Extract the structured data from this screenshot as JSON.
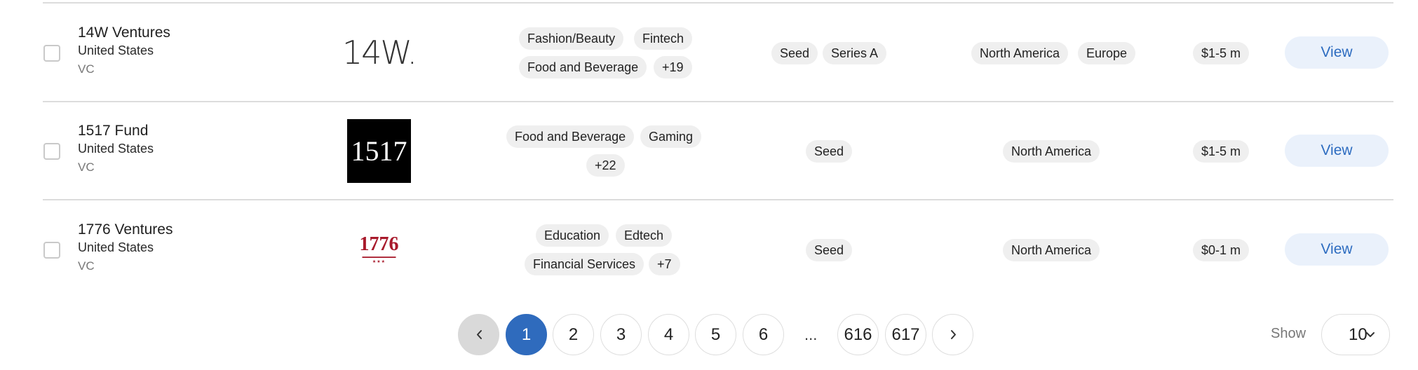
{
  "rows": [
    {
      "name": "14W Ventures",
      "country": "United States",
      "type": "VC",
      "logo_text": "14W.",
      "industries": [
        "Fashion/Beauty",
        "Fintech",
        "Food and Beverage",
        "+19"
      ],
      "stages": [
        "Seed",
        "Series A"
      ],
      "regions": [
        "North America",
        "Europe"
      ],
      "check_size": "$1-5 m",
      "action": "View"
    },
    {
      "name": "1517 Fund",
      "country": "United States",
      "type": "VC",
      "logo_text": "1517",
      "industries": [
        "Food and Beverage",
        "Gaming",
        "+22"
      ],
      "stages": [
        "Seed"
      ],
      "regions": [
        "North America"
      ],
      "check_size": "$1-5 m",
      "action": "View"
    },
    {
      "name": "1776 Ventures",
      "country": "United States",
      "type": "VC",
      "logo_text": "1776",
      "industries": [
        "Education",
        "Edtech",
        "Financial Services",
        "+7"
      ],
      "stages": [
        "Seed"
      ],
      "regions": [
        "North America"
      ],
      "check_size": "$0-1 m",
      "action": "View"
    }
  ],
  "pagination": {
    "pages": [
      "1",
      "2",
      "3",
      "4",
      "5",
      "6",
      "616",
      "617"
    ],
    "ellipsis": "...",
    "current": "1",
    "prev_icon": "chevron-left-icon",
    "next_icon": "chevron-right-icon"
  },
  "page_size": {
    "label": "Show",
    "value": "10"
  },
  "colors": {
    "accent": "#2f6bbd",
    "view_text": "#2d6cc0",
    "view_bg": "#eaf1fb",
    "pill_bg": "#efefef",
    "logo_1776_red": "#a8192b"
  }
}
